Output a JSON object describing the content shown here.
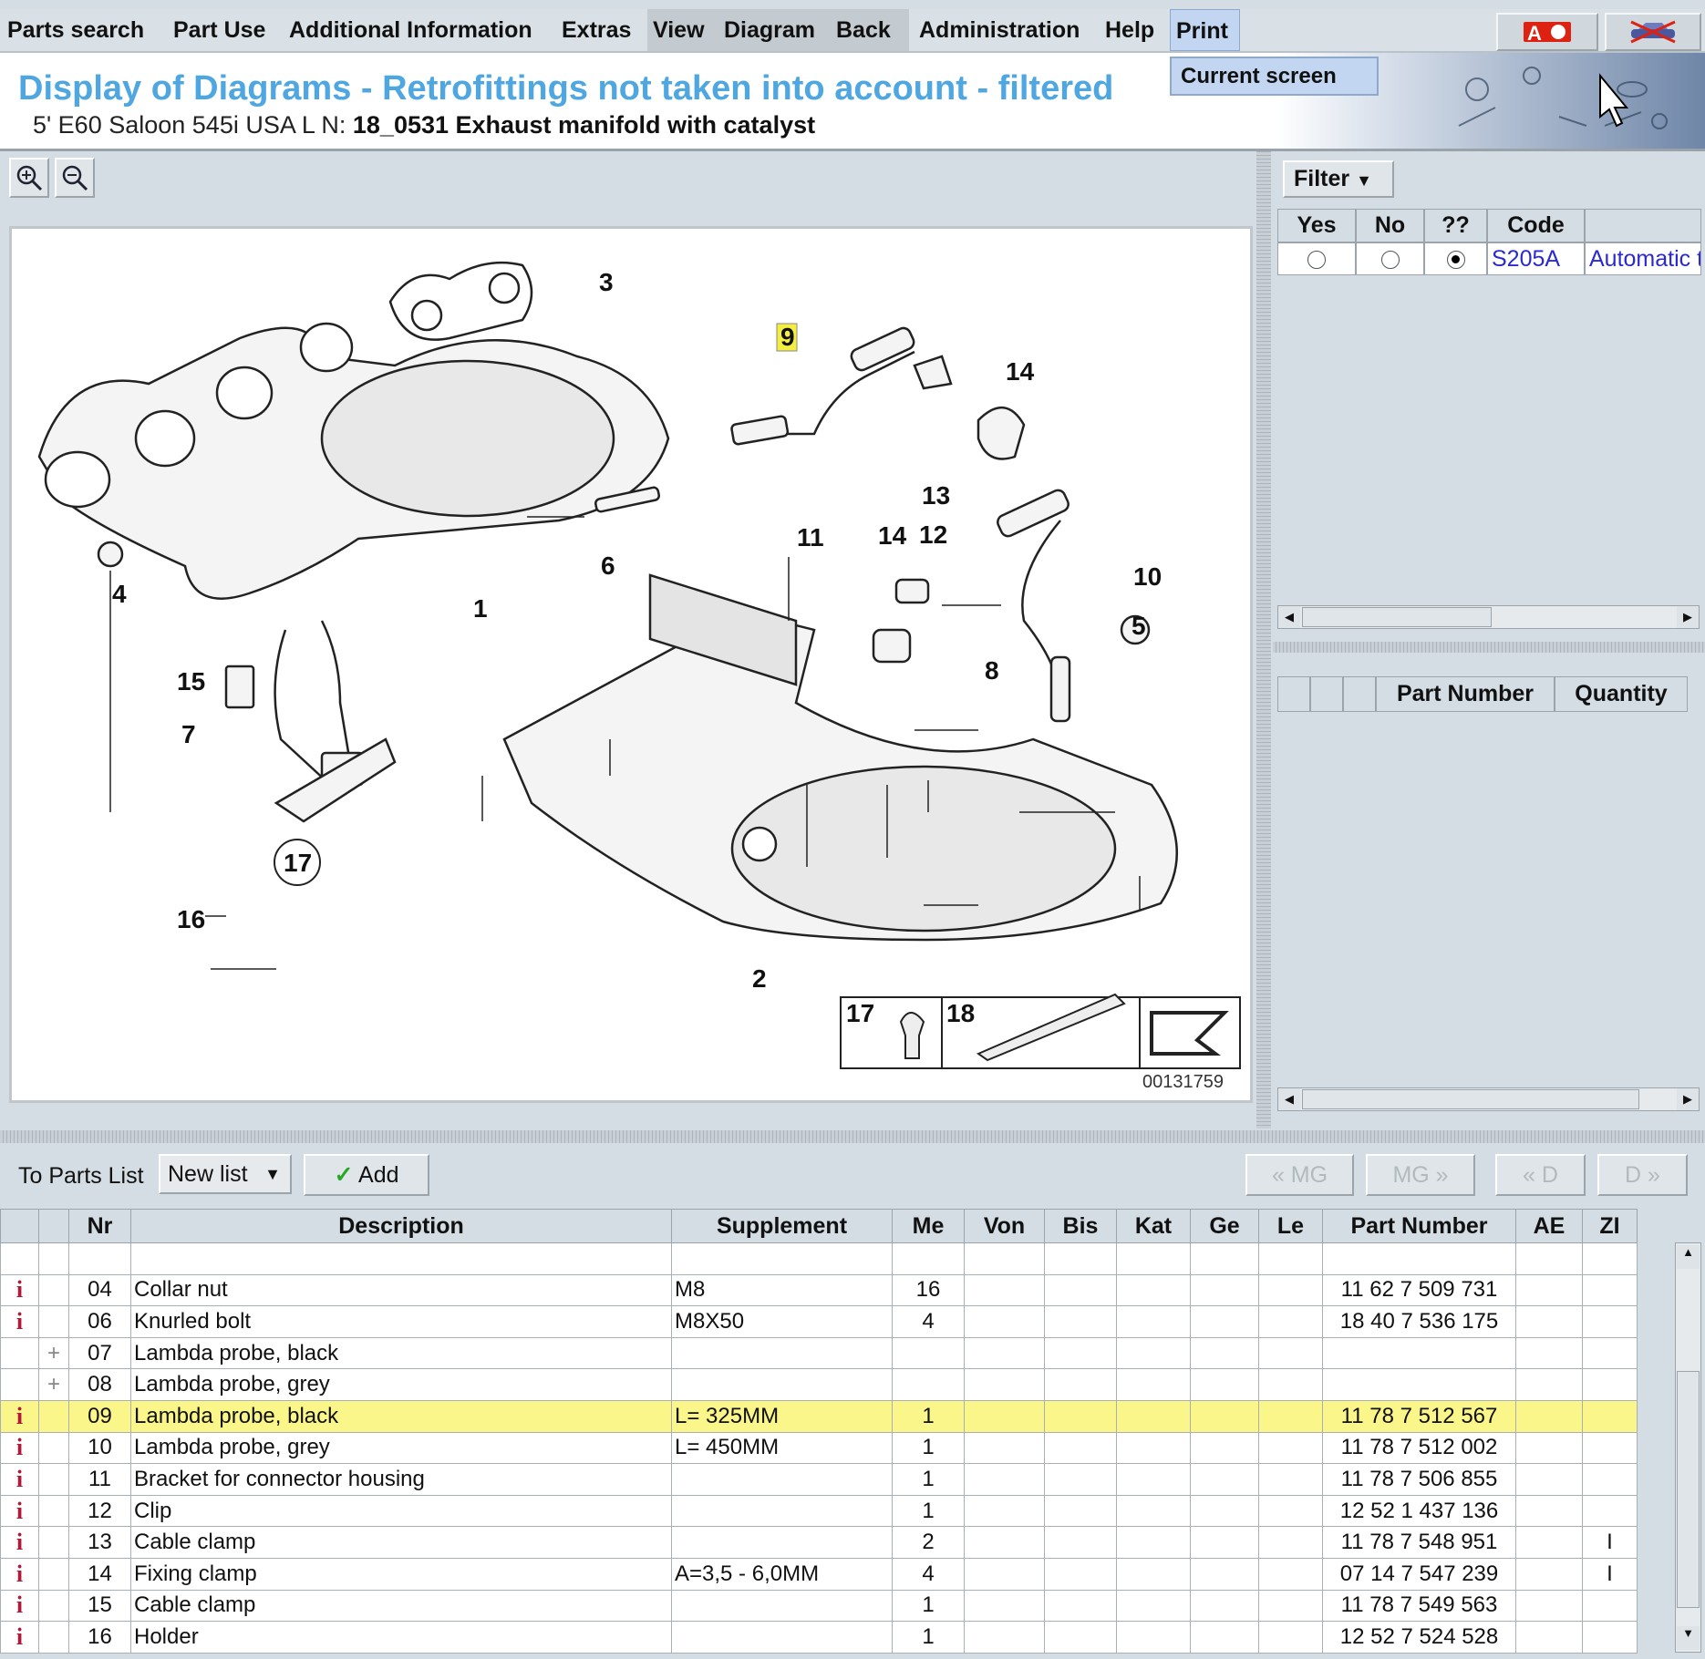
{
  "menu": {
    "items": [
      "Parts search",
      "Part Use",
      "Additional Information",
      "Extras",
      "View",
      "Diagram",
      "Back",
      "Administration",
      "Help",
      "Print"
    ],
    "print_dropdown": [
      "Current screen"
    ],
    "right_icons": [
      "language-flag-icon",
      "vehicle-icon"
    ]
  },
  "header": {
    "title": "Display of Diagrams - Retrofittings not taken into account - filtered",
    "vehicle": "5' E60 Saloon 545i USA  L N: ",
    "group": "18_0531 Exhaust manifold with catalyst"
  },
  "diagram": {
    "callouts": [
      "3",
      "9",
      "14",
      "13",
      "11",
      "14",
      "12",
      "10",
      "5",
      "8",
      "6",
      "1",
      "4",
      "15",
      "7",
      "17",
      "16",
      "2"
    ],
    "highlighted": "9",
    "legend": [
      "17",
      "18"
    ],
    "image_number": "00131759"
  },
  "filter": {
    "button": "Filter",
    "headers": [
      "Yes",
      "No",
      "??",
      "Code",
      ""
    ],
    "rows": [
      {
        "selected": "??",
        "code": "S205A",
        "description": "Automatic t"
      }
    ]
  },
  "parts_panel": {
    "headers": [
      "",
      "",
      "",
      "Part Number",
      "Quantity"
    ]
  },
  "toolbar": {
    "to_parts_list": "To Parts List",
    "list_select": "New list",
    "add": "Add",
    "nav": [
      "« MG",
      "MG »",
      "« D",
      "D »"
    ]
  },
  "table": {
    "headers": [
      "",
      "",
      "Nr",
      "Description",
      "Supplement",
      "Me",
      "Von",
      "Bis",
      "Kat",
      "Ge",
      "Le",
      "Part Number",
      "AE",
      "ZI"
    ],
    "rows": [
      {
        "icon": "info",
        "nr": "04",
        "desc": "Collar nut",
        "supp": "M8",
        "me": "16",
        "pn": "11 62 7 509 731",
        "zi": ""
      },
      {
        "icon": "info",
        "nr": "06",
        "desc": "Knurled bolt",
        "supp": "M8X50",
        "me": "4",
        "pn": "18 40 7 536 175",
        "zi": ""
      },
      {
        "icon": "plus",
        "nr": "07",
        "desc": "Lambda probe, black",
        "supp": "",
        "me": "",
        "pn": "",
        "zi": ""
      },
      {
        "icon": "plus",
        "nr": "08",
        "desc": "Lambda probe, grey",
        "supp": "",
        "me": "",
        "pn": "",
        "zi": ""
      },
      {
        "icon": "info",
        "nr": "09",
        "desc": "Lambda probe, black",
        "supp": "L= 325MM",
        "me": "1",
        "pn": "11 78 7 512 567",
        "zi": "",
        "highlight": true
      },
      {
        "icon": "info",
        "nr": "10",
        "desc": "Lambda probe, grey",
        "supp": "L= 450MM",
        "me": "1",
        "pn": "11 78 7 512 002",
        "zi": ""
      },
      {
        "icon": "info",
        "nr": "11",
        "desc": "Bracket for connector housing",
        "supp": "",
        "me": "1",
        "pn": "11 78 7 506 855",
        "zi": ""
      },
      {
        "icon": "info",
        "nr": "12",
        "desc": "Clip",
        "supp": "",
        "me": "1",
        "pn": "12 52 1 437 136",
        "zi": ""
      },
      {
        "icon": "info",
        "nr": "13",
        "desc": "Cable clamp",
        "supp": "",
        "me": "2",
        "pn": "11 78 7 548 951",
        "zi": "I",
        "flag": true
      },
      {
        "icon": "info",
        "nr": "14",
        "desc": "Fixing clamp",
        "supp": "A=3,5 - 6,0MM",
        "me": "4",
        "pn": "07 14 7 547 239",
        "zi": "I",
        "flag": true
      },
      {
        "icon": "info",
        "nr": "15",
        "desc": "Cable clamp",
        "supp": "",
        "me": "1",
        "pn": "11 78 7 549 563",
        "zi": ""
      },
      {
        "icon": "info",
        "nr": "16",
        "desc": "Holder",
        "supp": "",
        "me": "1",
        "pn": "12 52 7 524 528",
        "zi": ""
      }
    ]
  },
  "colors": {
    "title": "#4ea7e0",
    "highlight": "#fbf68a",
    "info_icon": "#b0193a",
    "code_link": "#2a2ad0",
    "menu_active": "#c2d6f2"
  }
}
